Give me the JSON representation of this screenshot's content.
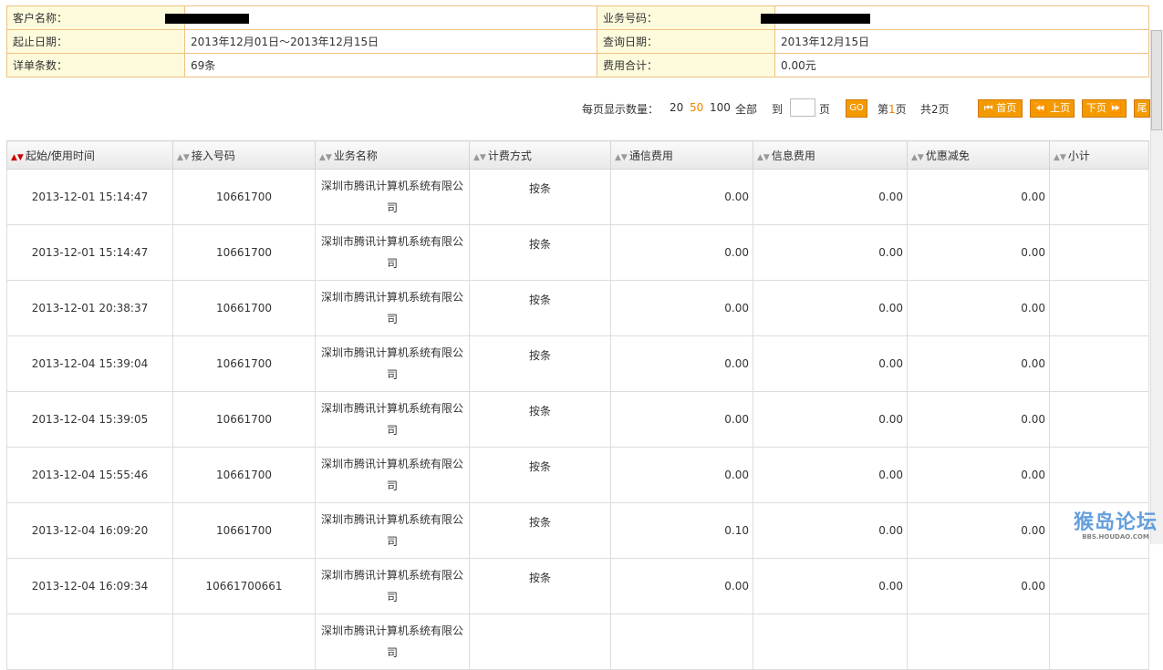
{
  "info": {
    "customer_label": "客户名称：",
    "business_no_label": "业务号码：",
    "period_label": "起止日期：",
    "period_value": "2013年12月01日～2013年12月15日",
    "query_date_label": "查询日期：",
    "query_date_value": "2013年12月15日",
    "record_count_label": "详单条数：",
    "record_count_value": "69条",
    "fee_total_label": "费用合计：",
    "fee_total_value": "0.00元"
  },
  "pager": {
    "per_page_label": "每页显示数量：",
    "opt_20": "20",
    "opt_50": "50",
    "opt_100": "100",
    "opt_all": "全部",
    "goto_label": "到",
    "page_unit": "页",
    "go_label": "GO",
    "current_prefix": "第",
    "current_page": "1",
    "current_suffix": "页",
    "total_prefix": "共",
    "total_pages": "2",
    "total_suffix": "页",
    "first_label": "⏮ 首页",
    "prev_label": "⏪ 上页",
    "next_label": "下页 ⏩",
    "last_label": "尾"
  },
  "columns": {
    "time": "起始/使用时间",
    "number": "接入号码",
    "service": "业务名称",
    "billing": "计费方式",
    "comm_fee": "通信费用",
    "info_fee": "信息费用",
    "discount": "优惠减免",
    "subtotal": "小计"
  },
  "rows": [
    {
      "time": "2013-12-01 15:14:47",
      "number": "10661700",
      "service": "深圳市腾讯计算机系统有限公司",
      "billing": "按条",
      "comm_fee": "0.00",
      "info_fee": "0.00",
      "discount": "0.00"
    },
    {
      "time": "2013-12-01 15:14:47",
      "number": "10661700",
      "service": "深圳市腾讯计算机系统有限公司",
      "billing": "按条",
      "comm_fee": "0.00",
      "info_fee": "0.00",
      "discount": "0.00"
    },
    {
      "time": "2013-12-01 20:38:37",
      "number": "10661700",
      "service": "深圳市腾讯计算机系统有限公司",
      "billing": "按条",
      "comm_fee": "0.00",
      "info_fee": "0.00",
      "discount": "0.00"
    },
    {
      "time": "2013-12-04 15:39:04",
      "number": "10661700",
      "service": "深圳市腾讯计算机系统有限公司",
      "billing": "按条",
      "comm_fee": "0.00",
      "info_fee": "0.00",
      "discount": "0.00"
    },
    {
      "time": "2013-12-04 15:39:05",
      "number": "10661700",
      "service": "深圳市腾讯计算机系统有限公司",
      "billing": "按条",
      "comm_fee": "0.00",
      "info_fee": "0.00",
      "discount": "0.00"
    },
    {
      "time": "2013-12-04 15:55:46",
      "number": "10661700",
      "service": "深圳市腾讯计算机系统有限公司",
      "billing": "按条",
      "comm_fee": "0.00",
      "info_fee": "0.00",
      "discount": "0.00"
    },
    {
      "time": "2013-12-04 16:09:20",
      "number": "10661700",
      "service": "深圳市腾讯计算机系统有限公司",
      "billing": "按条",
      "comm_fee": "0.10",
      "info_fee": "0.00",
      "discount": "0.00"
    },
    {
      "time": "2013-12-04 16:09:34",
      "number": "10661700661",
      "service": "深圳市腾讯计算机系统有限公司",
      "billing": "按条",
      "comm_fee": "0.00",
      "info_fee": "0.00",
      "discount": "0.00"
    },
    {
      "time": "",
      "number": "",
      "service": "深圳市腾讯计算机系统有限公司",
      "billing": "",
      "comm_fee": "",
      "info_fee": "",
      "discount": ""
    }
  ],
  "watermark": {
    "text": "猴岛论坛",
    "sub": "BBS.HOUDAO.COM"
  },
  "colors": {
    "accent": "#f39a00",
    "label_bg": "#fefbdc",
    "border": "#f0c080"
  }
}
